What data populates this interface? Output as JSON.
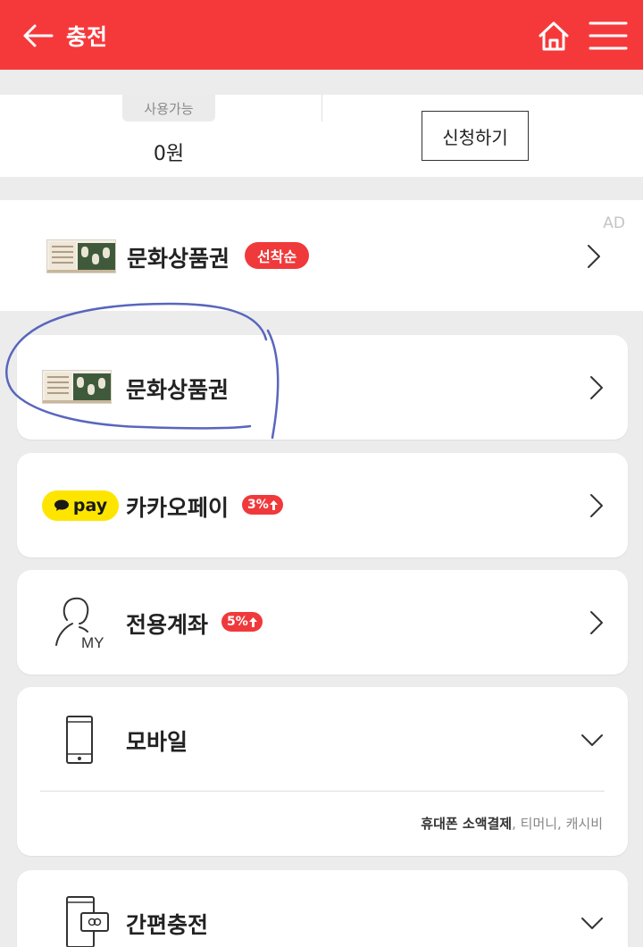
{
  "header": {
    "title": "충전",
    "bg_color": "#f5393b"
  },
  "balance": {
    "available_label": "사용가능",
    "amount": "0원",
    "apply_label": "신청하기"
  },
  "ad": {
    "tag": "AD",
    "label": "문화상품권",
    "badge": "선착순"
  },
  "menu": {
    "culture_voucher": {
      "label": "문화상품권"
    },
    "kakao_pay": {
      "pill_text": "pay",
      "label": "카카오페이",
      "badge": "3%"
    },
    "dedicated_account": {
      "label": "전용계좌",
      "badge": "5%",
      "icon_text": "MY"
    },
    "mobile": {
      "label": "모바일",
      "note_strong": "휴대폰 소액결제",
      "note_sep": ",",
      "note_rest": " 티머니, 캐시비"
    },
    "easy_charge": {
      "label": "간편충전"
    }
  },
  "colors": {
    "accent": "#f0393b",
    "kakao_yellow": "#fee500",
    "scribble": "#5866bd"
  }
}
